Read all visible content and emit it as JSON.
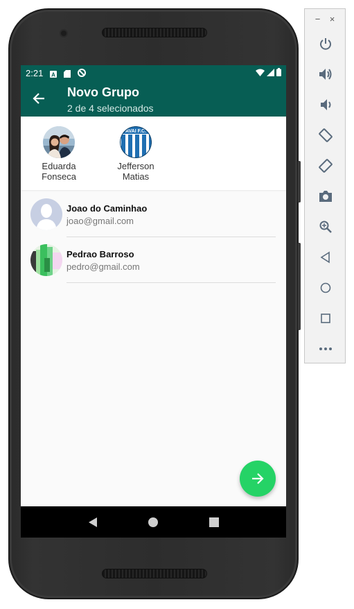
{
  "status_bar": {
    "time": "2:21"
  },
  "app_bar": {
    "title": "Novo Grupo",
    "subtitle": "2 de 4 selecionados"
  },
  "selected": [
    {
      "first": "Eduarda",
      "last": "Fonseca"
    },
    {
      "first": "Jefferson",
      "last": "Matias",
      "badge": "AVAI F.C."
    }
  ],
  "contacts": [
    {
      "name": "Joao do Caminhao",
      "email": "joao@gmail.com"
    },
    {
      "name": "Pedrao Barroso",
      "email": "pedro@gmail.com"
    }
  ],
  "colors": {
    "primary": "#075e54",
    "fab": "#25d366",
    "background": "#fafafa"
  },
  "toolbar": {
    "window_controls": [
      "−",
      "×"
    ],
    "icons": [
      "power-icon",
      "volume-up-icon",
      "volume-down-icon",
      "rotate-left-icon",
      "rotate-right-icon",
      "camera-icon",
      "zoom-icon",
      "back-icon",
      "home-icon",
      "overview-icon",
      "more-icon"
    ]
  }
}
